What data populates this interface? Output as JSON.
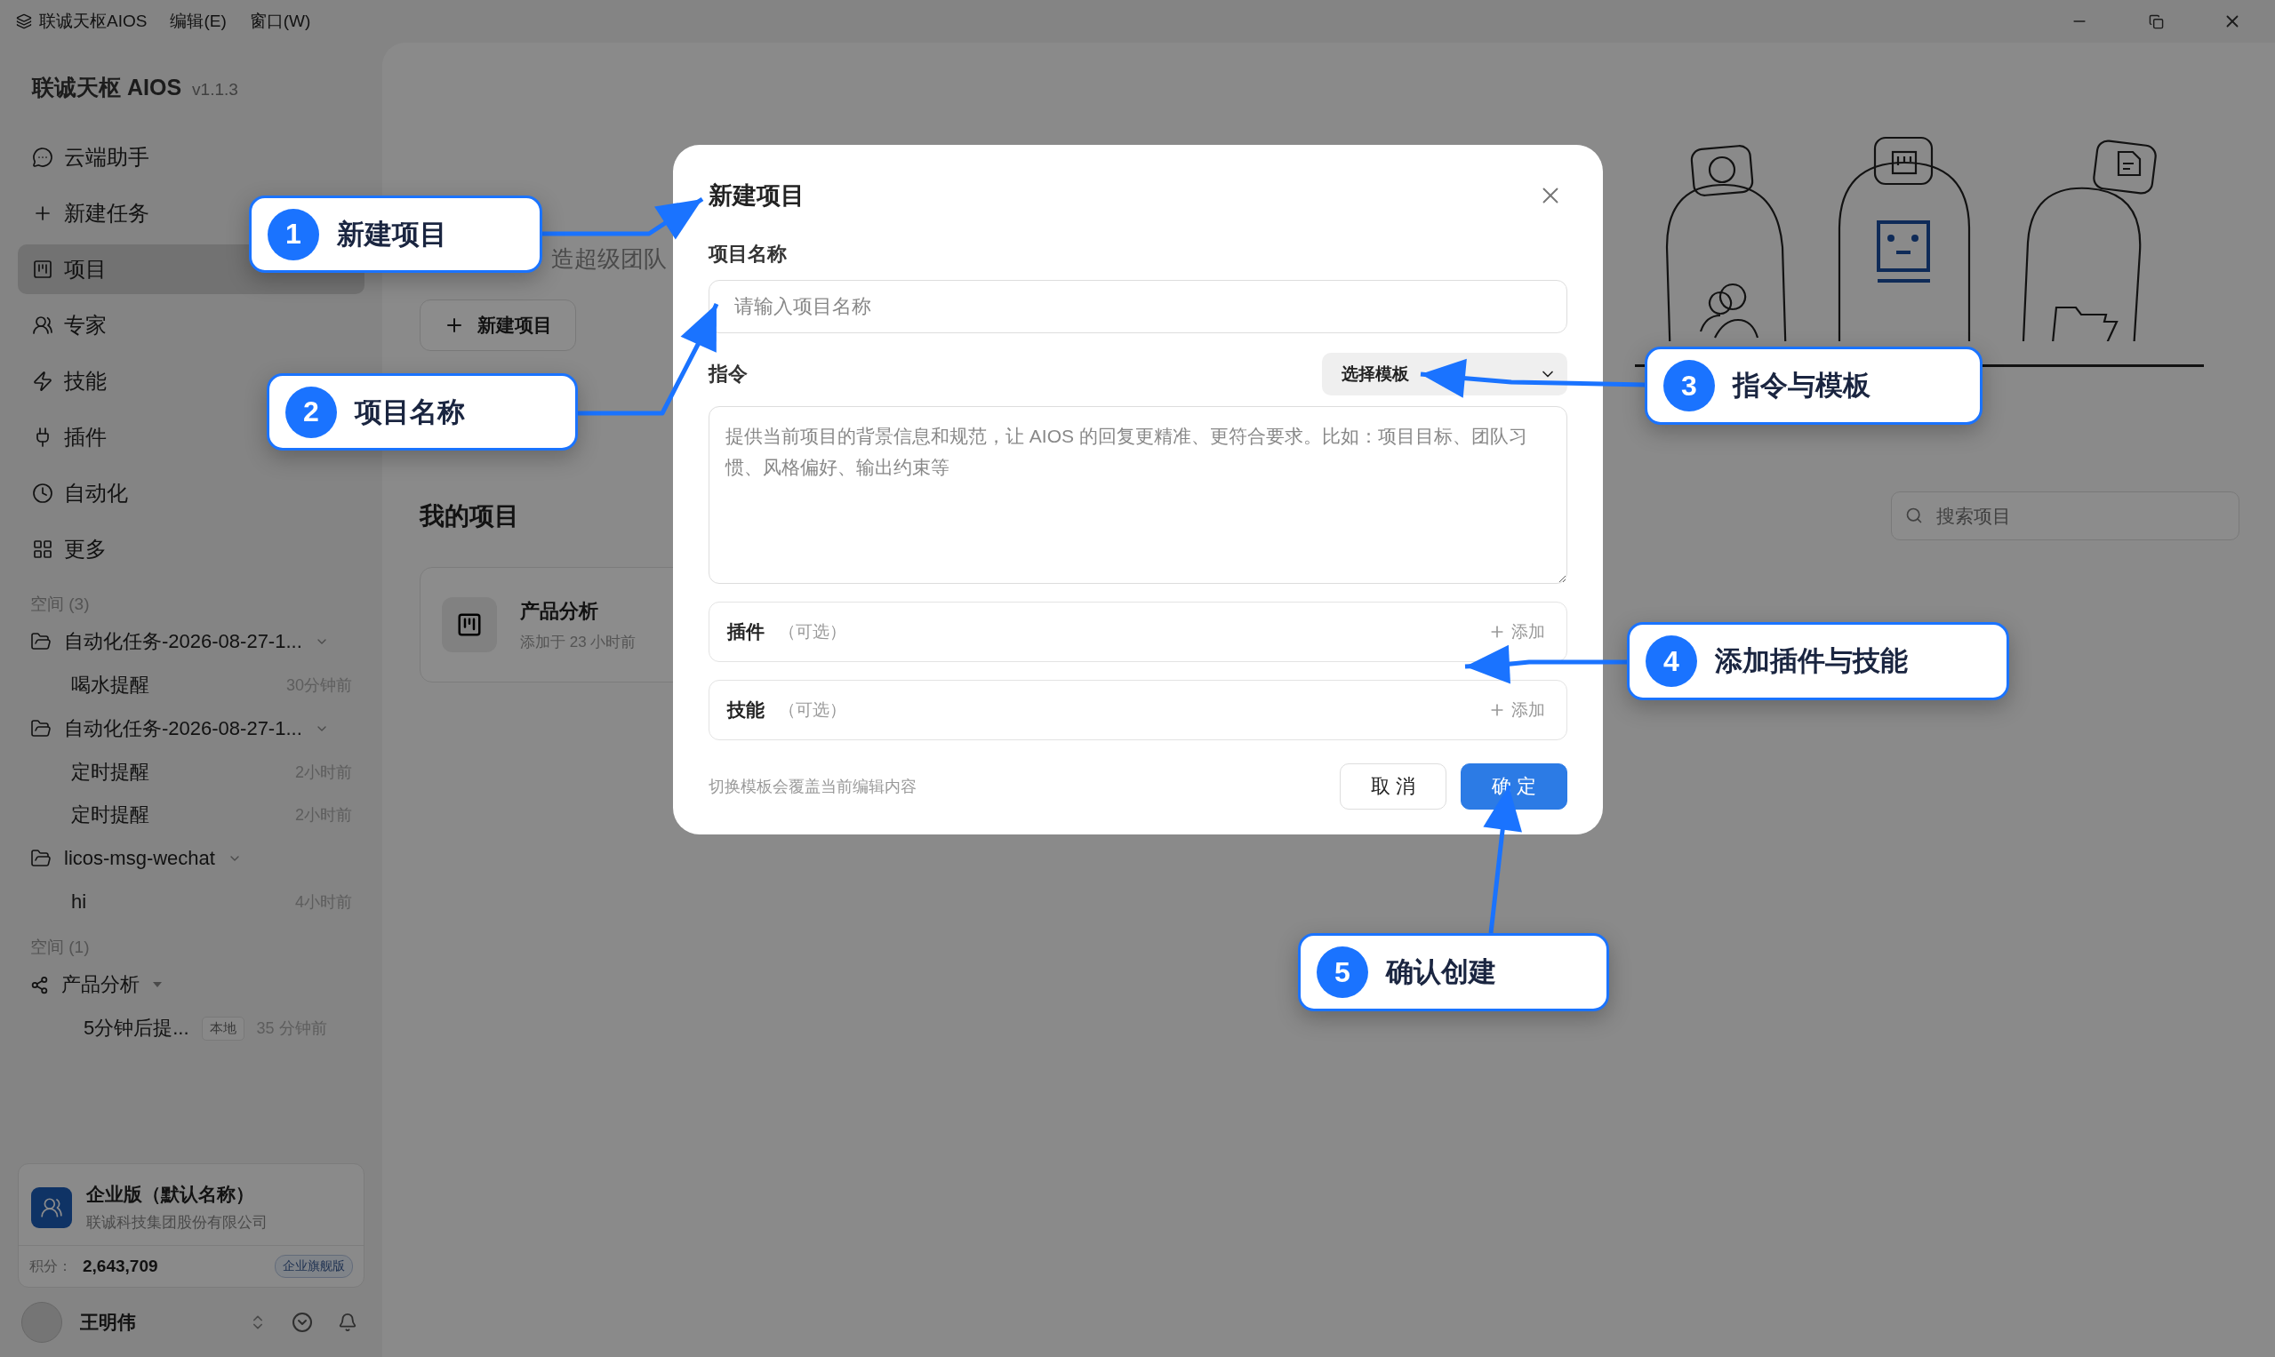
{
  "menu_bar": {
    "app": "联诚天枢AIOS",
    "items": [
      "编辑(E)",
      "窗口(W)"
    ]
  },
  "sidebar": {
    "brand": "联诚天枢 AIOS",
    "version": "v1.1.3",
    "nav": [
      {
        "label": "云端助手",
        "selected": false
      },
      {
        "label": "新建任务",
        "selected": false
      },
      {
        "label": "项目",
        "selected": true
      },
      {
        "label": "专家",
        "selected": false
      },
      {
        "label": "技能",
        "selected": false
      },
      {
        "label": "插件",
        "selected": false
      },
      {
        "label": "自动化",
        "selected": false
      },
      {
        "label": "更多",
        "selected": false
      }
    ],
    "spaces": [
      {
        "header": "空间 (3)",
        "groups": [
          {
            "kind": "folder",
            "name": "自动化任务-2026-08-27-1...",
            "expanded": true,
            "children": [
              {
                "name": "喝水提醒",
                "time": "30分钟前"
              }
            ]
          },
          {
            "kind": "folder",
            "name": "自动化任务-2026-08-27-1...",
            "expanded": true,
            "children": [
              {
                "name": "定时提醒",
                "time": "2小时前"
              },
              {
                "name": "定时提醒",
                "time": "2小时前"
              }
            ]
          },
          {
            "kind": "folder",
            "name": "licos-msg-wechat",
            "expanded": true,
            "children": [
              {
                "name": "hi",
                "time": "4小时前"
              }
            ]
          }
        ]
      },
      {
        "header": "空间 (1)",
        "groups": [
          {
            "kind": "shared",
            "name": "产品分析",
            "expanded": true,
            "children": [
              {
                "name": "5分钟后提...",
                "tag": "本地",
                "time": "35 分钟前"
              }
            ]
          }
        ]
      }
    ],
    "org_card": {
      "name": "企业版（默认名称）",
      "company": "联诚科技集团股份有限公司",
      "points_label": "积分：",
      "points": "2,643,709",
      "badge": "企业旗舰版"
    },
    "user": {
      "name": "王明伟"
    }
  },
  "main": {
    "subtitle": "造超级团队",
    "new_button": "新建项目",
    "section_title": "我的项目",
    "search_placeholder": "搜索项目",
    "projects": [
      {
        "name": "产品分析",
        "meta": "添加于 23 小时前"
      }
    ]
  },
  "dialog": {
    "title": "新建项目",
    "name_label": "项目名称",
    "name_placeholder": "请输入项目名称",
    "instruction_label": "指令",
    "template_select": "选择模板",
    "instruction_placeholder": "提供当前项目的背景信息和规范，让 AIOS 的回复更精准、更符合要求。比如：项目目标、团队习惯、风格偏好、输出约束等",
    "sections": [
      {
        "label": "插件",
        "hint": "（可选）",
        "add": "添加"
      },
      {
        "label": "技能",
        "hint": "（可选）",
        "add": "添加"
      }
    ],
    "footer_note": "切换模板会覆盖当前编辑内容",
    "cancel": "取 消",
    "confirm": "确 定"
  },
  "callouts": [
    {
      "number": "1",
      "label": "新建项目"
    },
    {
      "number": "2",
      "label": "项目名称"
    },
    {
      "number": "3",
      "label": "指令与模板"
    },
    {
      "number": "4",
      "label": "添加插件与技能"
    },
    {
      "number": "5",
      "label": "确认创建"
    }
  ]
}
